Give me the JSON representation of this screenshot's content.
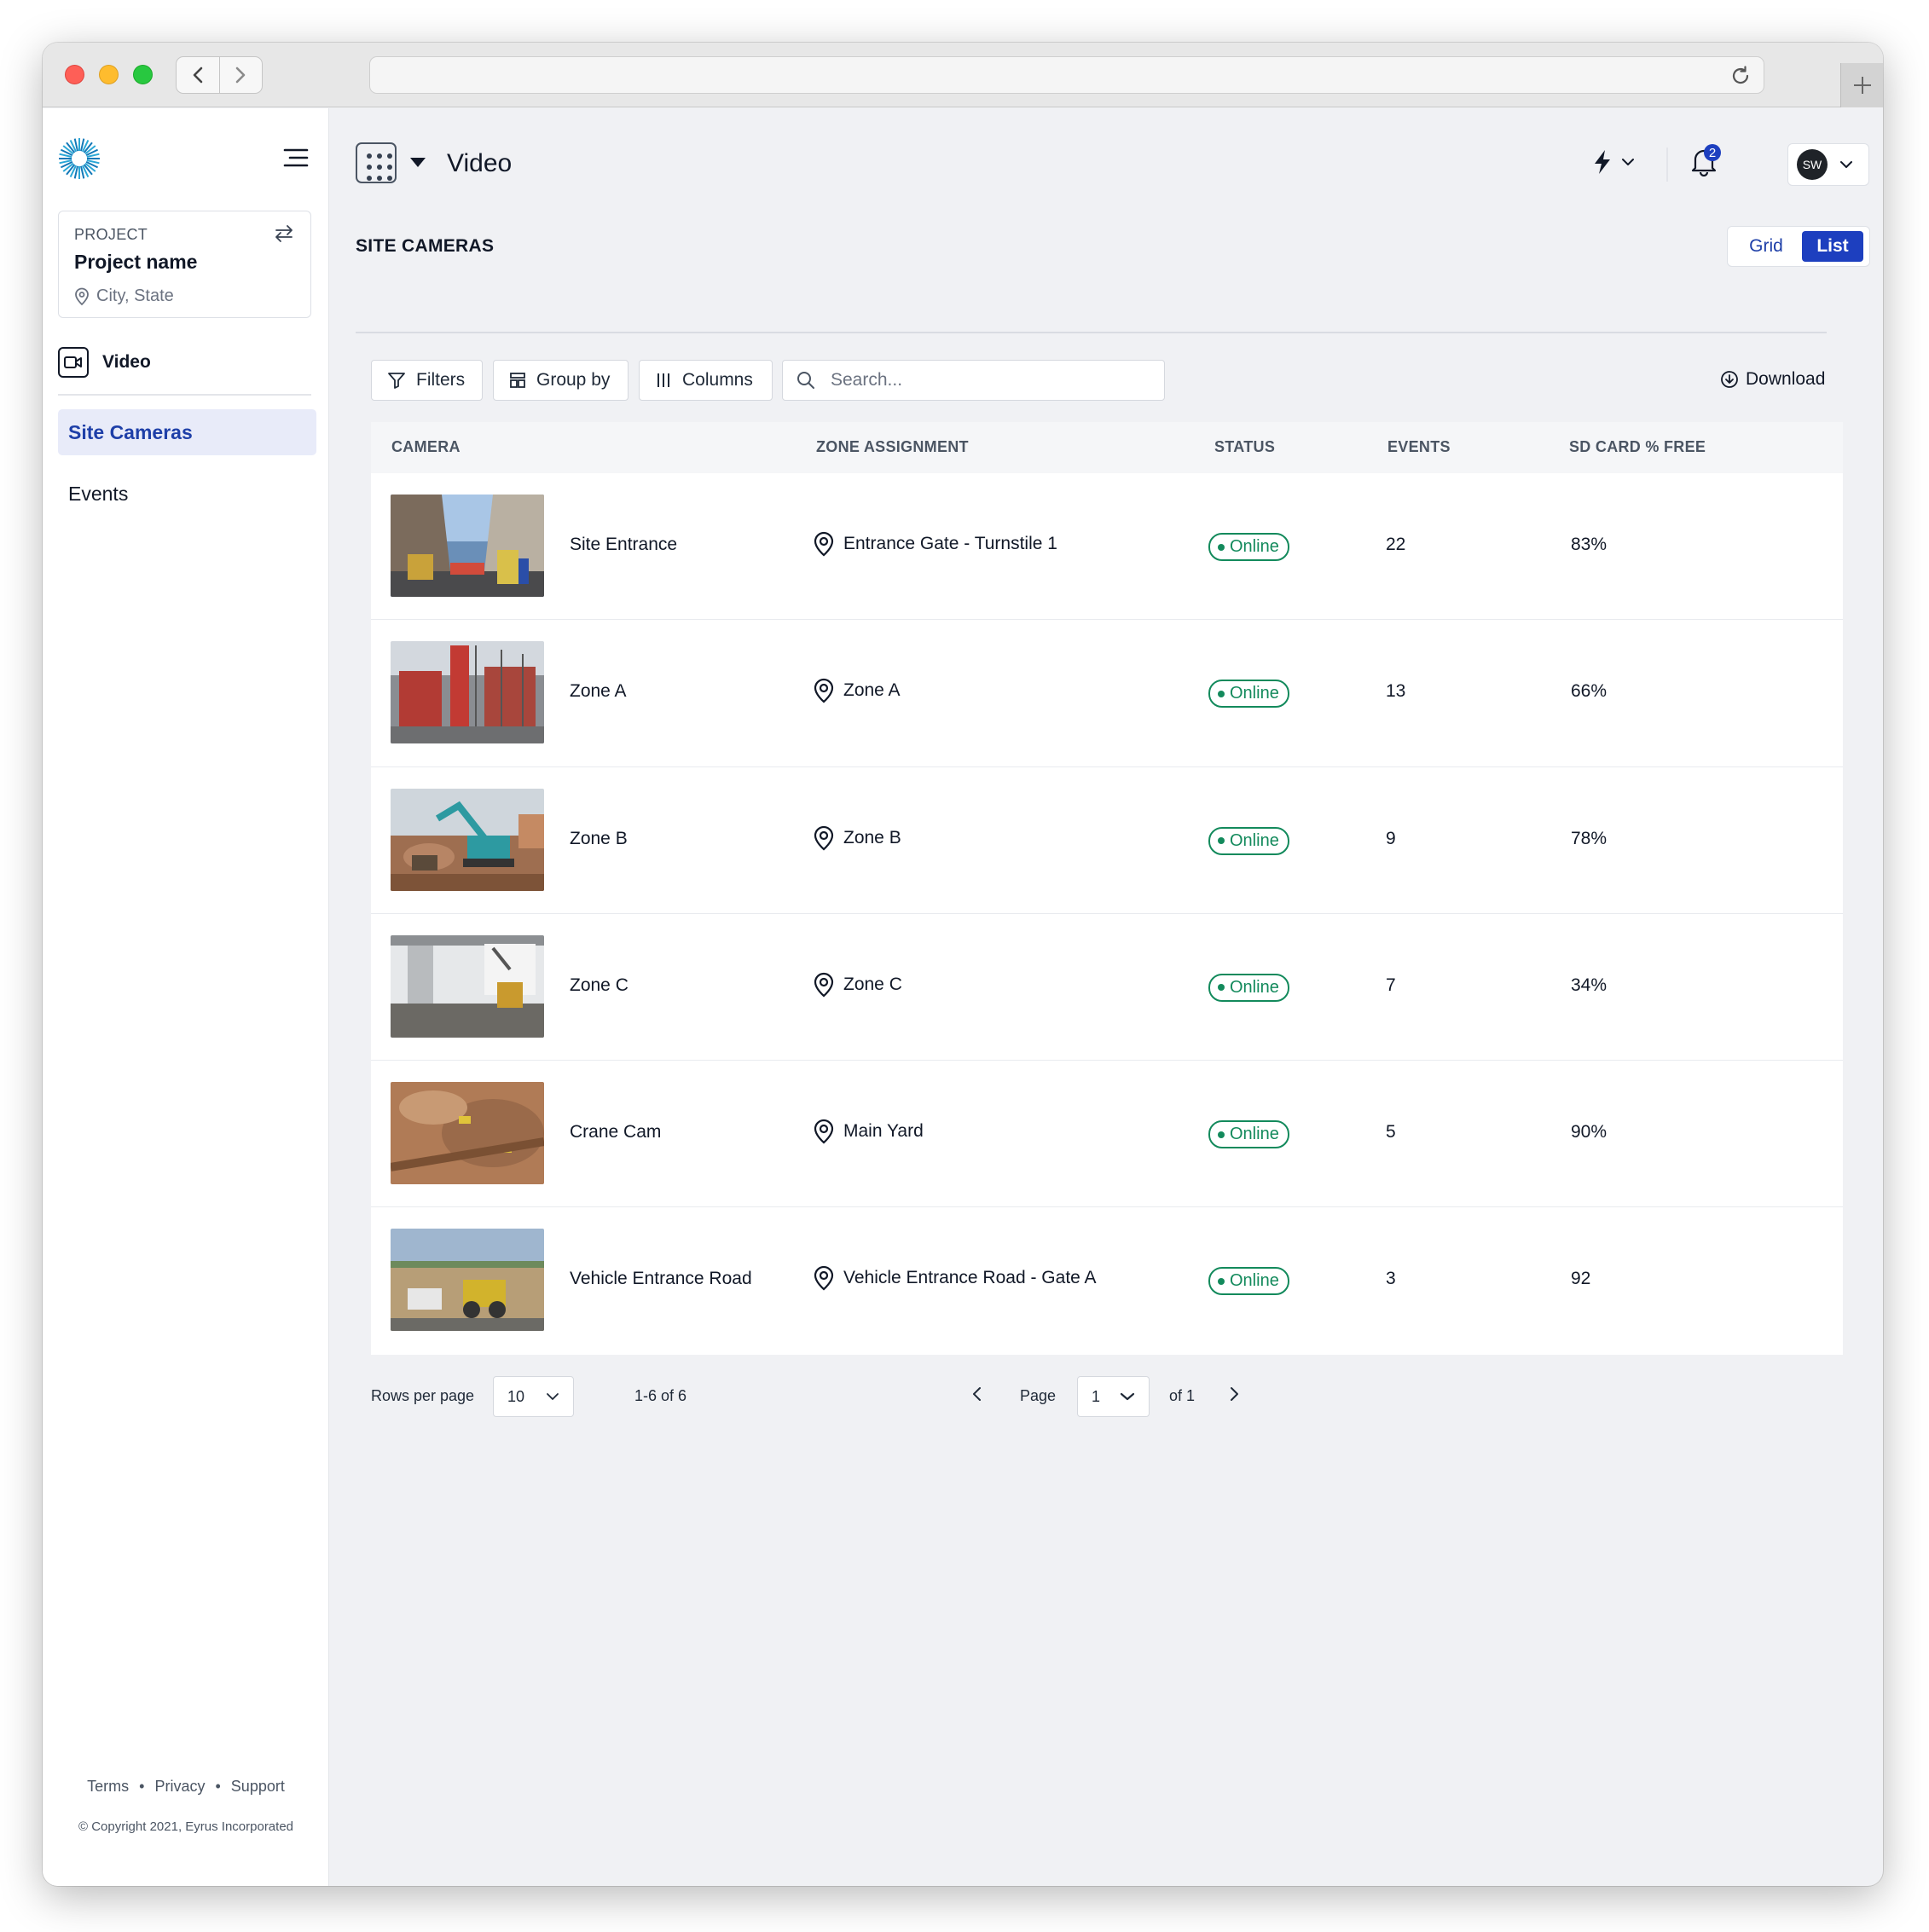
{
  "browser": {
    "url": ""
  },
  "sidebar": {
    "project_label": "PROJECT",
    "project_name": "Project name",
    "project_location": "City, State",
    "section_label": "Video",
    "items": [
      {
        "label": "Site Cameras",
        "active": true
      },
      {
        "label": "Events",
        "active": false
      }
    ],
    "footer": {
      "terms": "Terms",
      "privacy": "Privacy",
      "support": "Support",
      "dot": "•",
      "copyright": "© Copyright 2021, Eyrus Incorporated"
    }
  },
  "header": {
    "title": "Video",
    "notification_count": "2",
    "avatar_initials": "SW"
  },
  "section": {
    "title": "SITE CAMERAS",
    "view_toggle": {
      "grid": "Grid",
      "list": "List",
      "selected": "List"
    }
  },
  "toolbar": {
    "filters": "Filters",
    "group_by": "Group by",
    "columns": "Columns",
    "search_placeholder": "Search...",
    "download": "Download"
  },
  "table": {
    "columns": [
      "CAMERA",
      "ZONE ASSIGNMENT",
      "STATUS",
      "EVENTS",
      "SD CARD % FREE"
    ],
    "rows": [
      {
        "camera": "Site Entrance",
        "zone": "Entrance Gate - Turnstile 1",
        "status": "Online",
        "events": "22",
        "sd_free": "83%",
        "thumb": "street-construction"
      },
      {
        "camera": "Zone A",
        "zone": "Zone A",
        "status": "Online",
        "events": "13",
        "sd_free": "66%",
        "thumb": "red-formwork"
      },
      {
        "camera": "Zone B",
        "zone": "Zone B",
        "status": "Online",
        "events": "9",
        "sd_free": "78%",
        "thumb": "excavator"
      },
      {
        "camera": "Zone C",
        "zone": "Zone C",
        "status": "Online",
        "events": "7",
        "sd_free": "34%",
        "thumb": "concrete-interior"
      },
      {
        "camera": "Crane Cam",
        "zone": "Main Yard",
        "status": "Online",
        "events": "5",
        "sd_free": "90%",
        "thumb": "aerial-dirt"
      },
      {
        "camera": "Vehicle Entrance Road",
        "zone": "Vehicle Entrance Road - Gate A",
        "status": "Online",
        "events": "3",
        "sd_free": "92",
        "thumb": "loader-site"
      }
    ]
  },
  "pagination": {
    "rows_per_page_label": "Rows per page",
    "rows_per_page": "10",
    "range": "1-6 of 6",
    "page_label": "Page",
    "page": "1",
    "of_label": "of 1"
  },
  "colors": {
    "accent": "#1d3fbf",
    "online": "#138a5c",
    "active_nav_bg": "#e8ebf9"
  }
}
